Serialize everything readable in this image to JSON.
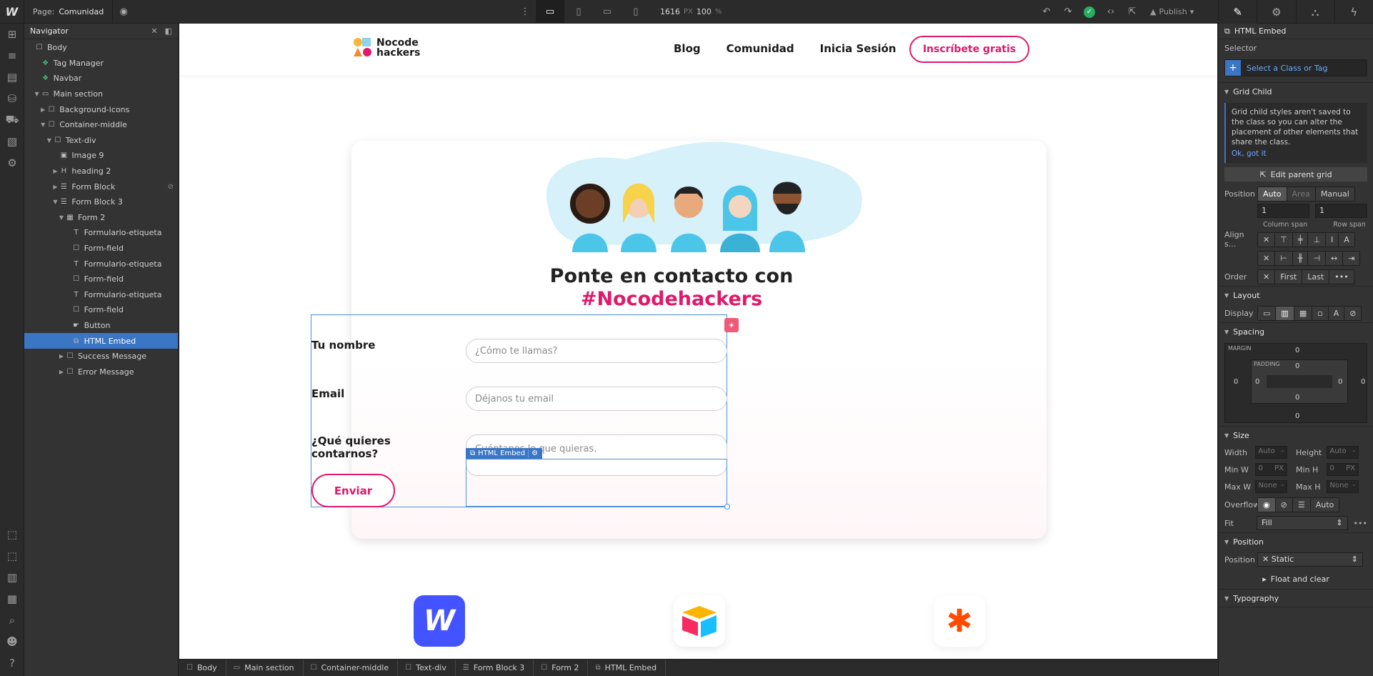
{
  "topbar": {
    "page_label": "Page:",
    "page_name": "Comunidad",
    "width_value": "1616",
    "width_unit": "PX",
    "zoom_value": "100",
    "zoom_unit": "%",
    "publish_label": "Publish"
  },
  "navigator": {
    "title": "Navigator",
    "items": [
      {
        "label": "Body",
        "level": 0,
        "caret": "",
        "icon": "body"
      },
      {
        "label": "Tag Manager",
        "level": 1,
        "caret": "",
        "icon": "symbol"
      },
      {
        "label": "Navbar",
        "level": 1,
        "caret": "",
        "icon": "symbol"
      },
      {
        "label": "Main section",
        "level": 1,
        "caret": "open",
        "icon": "section"
      },
      {
        "label": "Background-icons",
        "level": 2,
        "caret": "closed",
        "icon": "div"
      },
      {
        "label": "Container-middle",
        "level": 2,
        "caret": "open",
        "icon": "div"
      },
      {
        "label": "Text-div",
        "level": 3,
        "caret": "open",
        "icon": "div"
      },
      {
        "label": "Image 9",
        "level": 4,
        "caret": "",
        "icon": "image"
      },
      {
        "label": "heading 2",
        "level": 4,
        "caret": "closed",
        "icon": "heading"
      },
      {
        "label": "Form Block",
        "level": 4,
        "caret": "closed",
        "icon": "form"
      },
      {
        "label": "Form Block 3",
        "level": 4,
        "caret": "open",
        "icon": "form"
      },
      {
        "label": "Form 2",
        "level": 5,
        "caret": "open",
        "icon": "grid"
      },
      {
        "label": "Formulario-etiqueta",
        "level": 6,
        "caret": "",
        "icon": "label"
      },
      {
        "label": "Form-field",
        "level": 6,
        "caret": "",
        "icon": "div"
      },
      {
        "label": "Formulario-etiqueta",
        "level": 6,
        "caret": "",
        "icon": "label"
      },
      {
        "label": "Form-field",
        "level": 6,
        "caret": "",
        "icon": "div"
      },
      {
        "label": "Formulario-etiqueta",
        "level": 6,
        "caret": "",
        "icon": "label"
      },
      {
        "label": "Form-field",
        "level": 6,
        "caret": "",
        "icon": "div"
      },
      {
        "label": "Button",
        "level": 6,
        "caret": "",
        "icon": "button"
      },
      {
        "label": "HTML Embed",
        "level": 6,
        "caret": "",
        "icon": "embed",
        "selected": true
      },
      {
        "label": "Success Message",
        "level": 5,
        "caret": "closed",
        "icon": "div"
      },
      {
        "label": "Error Message",
        "level": 5,
        "caret": "closed",
        "icon": "div"
      }
    ]
  },
  "site": {
    "brand_line1": "Nocode",
    "brand_line2": "hackers",
    "menu": [
      "Blog",
      "Comunidad",
      "Inicia Sesión"
    ],
    "cta": "Inscríbete gratis",
    "heading_line1": "Ponte en contacto con",
    "heading_line2": "#Nocodehackers",
    "form": {
      "name_label": "Tu nombre",
      "name_placeholder": "¿Cómo te llamas?",
      "email_label": "Email",
      "email_placeholder": "Déjanos tu email",
      "message_label_line1": "¿Qué quieres",
      "message_label_line2": "contarnos?",
      "message_placeholder": "Cuéntanos lo que quieras.",
      "submit": "Enviar"
    },
    "embed_badge": "HTML Embed",
    "webflow_letter": "W",
    "zapier_glyph": "✱"
  },
  "breadcrumbs": [
    "Body",
    "Main section",
    "Container-middle",
    "Text-div",
    "Form Block 3",
    "Form 2",
    "HTML Embed"
  ],
  "panel": {
    "element_name": "HTML Embed",
    "selector_label": "Selector",
    "selector_placeholder": "Select a Class or Tag",
    "grid_child_title": "Grid Child",
    "grid_note": "Grid child styles aren't saved to the class so you can alter the placement of other elements that share the class.",
    "grid_note_ok": "Ok, got it",
    "edit_parent_grid": "Edit parent grid",
    "position_label": "Position",
    "position_options": [
      "Auto",
      "Area",
      "Manual"
    ],
    "column_span_value": "1",
    "row_span_value": "1",
    "column_span_label": "Column span",
    "row_span_label": "Row span",
    "align_label": "Align s...",
    "order_label": "Order",
    "order_options": [
      "First",
      "Last"
    ],
    "layout_title": "Layout",
    "display_label": "Display",
    "spacing_title": "Spacing",
    "margin_label": "MARGIN",
    "padding_label": "PADDING",
    "zero": "0",
    "size_title": "Size",
    "width_label": "Width",
    "height_label": "Height",
    "minw_label": "Min W",
    "minh_label": "Min H",
    "maxw_label": "Max W",
    "maxh_label": "Max H",
    "auto": "Auto",
    "none": "None",
    "px": "PX",
    "overflow_label": "Overflow",
    "overflow_auto": "Auto",
    "fit_label": "Fit",
    "fit_value": "Fill",
    "position_title": "Position",
    "position_value": "Static",
    "float_clear": "Float and clear",
    "typography_title": "Typography"
  }
}
